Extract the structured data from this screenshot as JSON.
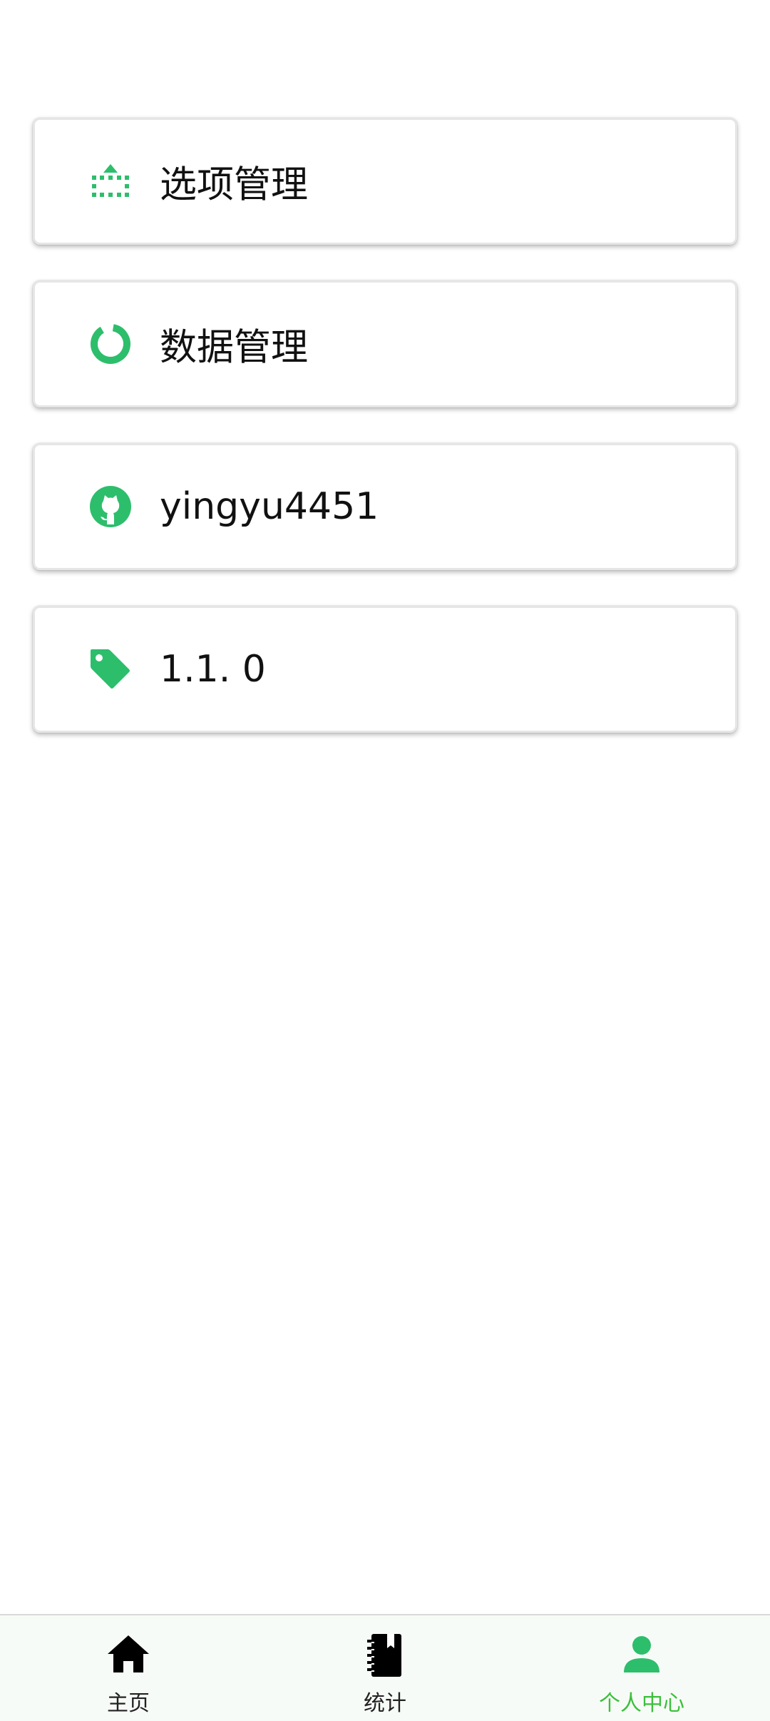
{
  "colors": {
    "accent": "#2dbe6c",
    "active_nav": "#3cbf3c",
    "text": "#111111"
  },
  "menu": {
    "items": [
      {
        "label": "选项管理",
        "icon": "upload-dotted-icon"
      },
      {
        "label": "数据管理",
        "icon": "donut-chart-icon"
      },
      {
        "label": "yingyu4451",
        "icon": "github-icon"
      },
      {
        "label": "1.1. 0",
        "icon": "tag-icon"
      }
    ]
  },
  "bottom_nav": {
    "items": [
      {
        "label": "主页",
        "icon": "home-icon",
        "active": false
      },
      {
        "label": "统计",
        "icon": "notebook-icon",
        "active": false
      },
      {
        "label": "个人中心",
        "icon": "person-icon",
        "active": true
      }
    ]
  }
}
